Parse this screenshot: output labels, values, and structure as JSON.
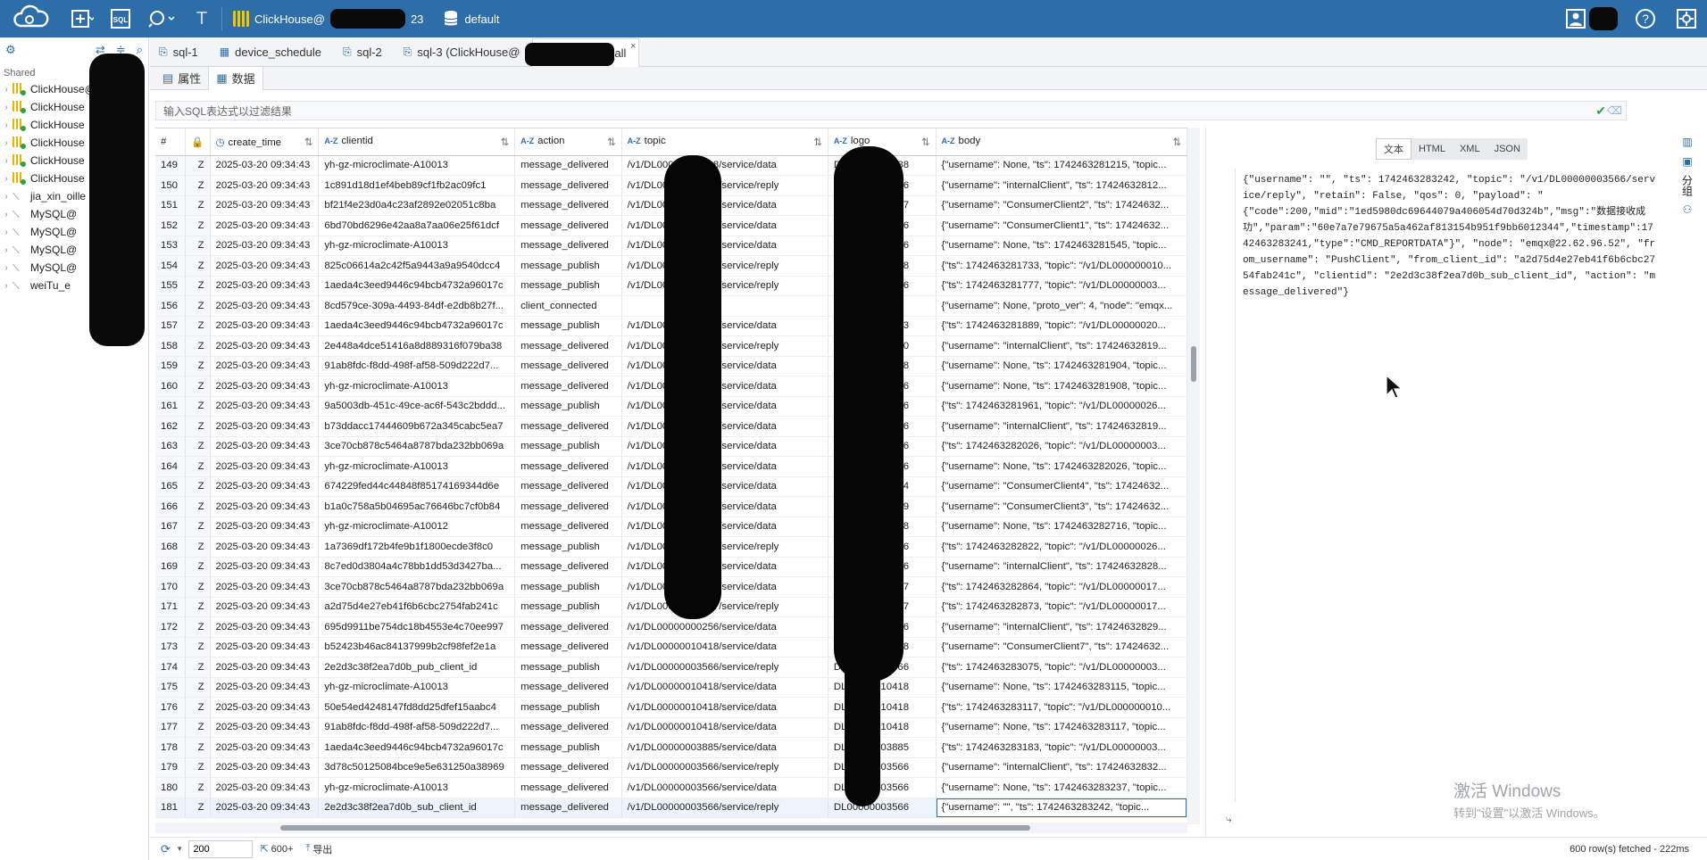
{
  "toolbar": {
    "connection_label": "ClickHouse@",
    "connection_suffix": "23",
    "database_label": "default"
  },
  "sidebar": {
    "shared_label": "Shared",
    "items": [
      {
        "label": "ClickHouse@",
        "type": "ch"
      },
      {
        "label": "ClickHouse",
        "type": "ch"
      },
      {
        "label": "ClickHouse",
        "type": "ch"
      },
      {
        "label": "ClickHouse",
        "type": "ch"
      },
      {
        "label": "ClickHouse",
        "type": "ch"
      },
      {
        "label": "ClickHouse",
        "type": "ch"
      },
      {
        "label": "jia_xin_oille",
        "type": "db"
      },
      {
        "label": "MySQL@",
        "type": "db"
      },
      {
        "label": "MySQL@",
        "type": "db"
      },
      {
        "label": "MySQL@",
        "type": "db"
      },
      {
        "label": "MySQL@",
        "type": "db"
      },
      {
        "label": "weiTu_e",
        "type": "db"
      }
    ]
  },
  "tabs": [
    {
      "label": "sql-1",
      "icon": "sql-script-icon"
    },
    {
      "label": "device_schedule",
      "icon": "table-icon"
    },
    {
      "label": "sql-2",
      "icon": "sql-script-icon"
    },
    {
      "label": "sql-3 (ClickHouse@",
      "icon": "sql-script-icon"
    },
    {
      "label": "emqx_log_all",
      "icon": "table-icon",
      "active": true
    }
  ],
  "subtabs": {
    "properties": "属性",
    "data": "数据"
  },
  "filter": {
    "placeholder": "输入SQL表达式以过滤结果"
  },
  "grid": {
    "columns": {
      "num": "#",
      "create_time": "create_time",
      "clientid": "clientid",
      "action": "action",
      "topic": "topic",
      "logo": "logo",
      "body": "body"
    },
    "type_az": "A-Z",
    "rows": [
      [
        "149",
        "Z",
        "2025-03-20 09:34:43",
        "yh-gz-microclimate-A10013",
        "message_delivered",
        "/v1/DL00000002238/service/data",
        "DL00000002238",
        "{\"username\": None, \"ts\": 1742463281215, \"topic..."
      ],
      [
        "150",
        "Z",
        "2025-03-20 09:34:43",
        "1c891d18d1ef4beb89cf1fb2ac09fc1",
        "message_delivered",
        "/v1/DL00000003486/service/reply",
        "DL00000003486",
        "{\"username\": \"internalClient\", \"ts\": 17424632812..."
      ],
      [
        "151",
        "Z",
        "2025-03-20 09:34:43",
        "bf21f4e23d0a4c23af2892e02051c8ba",
        "message_delivered",
        "/v1/DL00000001737/service/data",
        "DL00000001737",
        "{\"username\": \"ConsumerClient2\", \"ts\": 17424632..."
      ],
      [
        "152",
        "Z",
        "2025-03-20 09:34:43",
        "6bd70bd6296e42aa8a7aa06e25f61dcf",
        "message_delivered",
        "/v1/DL00000000256/service/data",
        "DL00000000256",
        "{\"username\": \"ConsumerClient1\", \"ts\": 17424632..."
      ],
      [
        "153",
        "Z",
        "2025-03-20 09:34:43",
        "yh-gz-microclimate-A10013",
        "message_delivered",
        "/v1/DL00000000256/service/data",
        "DL00000000256",
        "{\"username\": None, \"ts\": 1742463281545, \"topic..."
      ],
      [
        "154",
        "Z",
        "2025-03-20 09:34:43",
        "825c06614a2c42f5a9443a9a9540dcc4",
        "message_publish",
        "/v1/DL00000010418/service/reply",
        "DL00000010418",
        "{\"ts\": 1742463281733, \"topic\": \"/v1/DL000000010..."
      ],
      [
        "155",
        "Z",
        "2025-03-20 09:34:43",
        "1aeda4c3eed9446c94bcb4732a96017c",
        "message_publish",
        "/v1/DL00000003986/service/reply",
        "DL00000003986",
        "{\"ts\": 1742463281777, \"topic\": \"/v1/DL00000003..."
      ],
      [
        "156",
        "Z",
        "2025-03-20 09:34:43",
        "8cd579ce-309a-4493-84df-e2db8b27f...",
        "client_connected",
        "",
        "",
        "{\"username\": None, \"proto_ver\": 4, \"node\": \"emqx..."
      ],
      [
        "157",
        "Z",
        "2025-03-20 09:34:43",
        "1aeda4c3eed9446c94bcb4732a96017c",
        "message_publish",
        "/v1/DL00000002013/service/data",
        "DL00000002013",
        "{\"ts\": 1742463281889, \"topic\": \"/v1/DL00000020..."
      ],
      [
        "158",
        "Z",
        "2025-03-20 09:34:43",
        "2e448a4dce51416a8d889316f079ba38",
        "message_delivered",
        "/v1/DL00000010410/service/reply",
        "DL00000010410",
        "{\"username\": \"internalClient\", \"ts\": 17424632819..."
      ],
      [
        "159",
        "Z",
        "2025-03-20 09:34:43",
        "91ab8fdc-f8dd-498f-af58-509d222d7...",
        "message_delivered",
        "/v1/DL00000010418/service/data",
        "DL00000010418",
        "{\"username\": None, \"ts\": 1742463281904, \"topic..."
      ],
      [
        "160",
        "Z",
        "2025-03-20 09:34:43",
        "yh-gz-microclimate-A10013",
        "message_delivered",
        "/v1/DL00000000256/service/data",
        "DL00000000256",
        "{\"username\": None, \"ts\": 1742463281908, \"topic..."
      ],
      [
        "161",
        "Z",
        "2025-03-20 09:34:43",
        "9a5003db-451c-49ce-ac6f-543c2bddd...",
        "message_publish",
        "/v1/DL00000000256/service/data",
        "DL00000000256",
        "{\"ts\": 1742463281961, \"topic\": \"/v1/DL00000026..."
      ],
      [
        "162",
        "Z",
        "2025-03-20 09:34:43",
        "b73ddacc17444609b672a345cabc5ea7",
        "message_delivered",
        "/v1/DL00000000256/service/data",
        "DL00000000256",
        "{\"username\": \"internalClient\", \"ts\": 17424632819..."
      ],
      [
        "163",
        "Z",
        "2025-03-20 09:34:43",
        "3ce70cb878c5464a8787bda232bb069a",
        "message_publish",
        "/v1/DL00000003976/service/data",
        "DL00000003976",
        "{\"ts\": 1742463282026, \"topic\": \"/v1/DL00000003..."
      ],
      [
        "164",
        "Z",
        "2025-03-20 09:34:43",
        "yh-gz-microclimate-A10013",
        "message_delivered",
        "/v1/DL00000003976/service/data",
        "DL00000003976",
        "{\"username\": None, \"ts\": 1742463282026, \"topic..."
      ],
      [
        "165",
        "Z",
        "2025-03-20 09:34:43",
        "674229fed44c44848f85174169344d6e",
        "message_delivered",
        "/v1/DL00000014674/service/data",
        "DL00000014674",
        "{\"username\": \"ConsumerClient4\", \"ts\": 17424632..."
      ],
      [
        "166",
        "Z",
        "2025-03-20 09:34:43",
        "b1a0c758a5b04695ac76646bc7cf0b84",
        "message_delivered",
        "/v1/DL00000003789/service/data",
        "DL00000003789",
        "{\"username\": \"ConsumerClient3\", \"ts\": 17424632..."
      ],
      [
        "167",
        "Z",
        "2025-03-20 09:34:43",
        "yh-gz-microclimate-A10012",
        "message_delivered",
        "/v1/DL00000010418/service/data",
        "DL00000010418",
        "{\"username\": None, \"ts\": 1742463282716, \"topic..."
      ],
      [
        "168",
        "Z",
        "2025-03-20 09:34:43",
        "1a7369df172b4fe9b1f1800ecde3f8c0",
        "message_publish",
        "/v1/DL00000000256/service/reply",
        "DL00000000256",
        "{\"ts\": 1742463282822, \"topic\": \"/v1/DL00000026..."
      ],
      [
        "169",
        "Z",
        "2025-03-20 09:34:43",
        "8c7ed0d3804a4c78bb1dd53d3427ba...",
        "message_delivered",
        "/v1/DL00000000256/service/data",
        "DL00000000256",
        "{\"username\": \"internalClient\", \"ts\": 17424632828..."
      ],
      [
        "170",
        "Z",
        "2025-03-20 09:34:43",
        "3ce70cb878c5464a8787bda232bb069a",
        "message_publish",
        "/v1/DL00000001737/service/data",
        "DL00000001737",
        "{\"ts\": 1742463282864, \"topic\": \"/v1/DL00000017..."
      ],
      [
        "171",
        "Z",
        "2025-03-20 09:34:43",
        "a2d75d4e27eb41f6b6cbc2754fab241c",
        "message_publish",
        "/v1/DL00000001737/service/reply",
        "DL00000001737",
        "{\"ts\": 1742463282873, \"topic\": \"/v1/DL00000017..."
      ],
      [
        "172",
        "Z",
        "2025-03-20 09:34:43",
        "695d9911be754dc18b4553e4c70ee997",
        "message_delivered",
        "/v1/DL00000000256/service/data",
        "DL00000000256",
        "{\"username\": \"internalClient\", \"ts\": 17424632829..."
      ],
      [
        "173",
        "Z",
        "2025-03-20 09:34:43",
        "b52423b46ac84137999b2cf98fef2e1a",
        "message_delivered",
        "/v1/DL00000010418/service/data",
        "DL00000010418",
        "{\"username\": \"ConsumerClient7\", \"ts\": 17424632..."
      ],
      [
        "174",
        "Z",
        "2025-03-20 09:34:43",
        "2e2d3c38f2ea7d0b_pub_client_id",
        "message_publish",
        "/v1/DL00000003566/service/reply",
        "DL00000003566",
        "{\"ts\": 1742463283075, \"topic\": \"/v1/DL00000003..."
      ],
      [
        "175",
        "Z",
        "2025-03-20 09:34:43",
        "yh-gz-microclimate-A10013",
        "message_delivered",
        "/v1/DL00000010418/service/data",
        "DL00000010418",
        "{\"username\": None, \"ts\": 1742463283115, \"topic..."
      ],
      [
        "176",
        "Z",
        "2025-03-20 09:34:43",
        "50e54ed4248147fd8dd25dfef15aabc4",
        "message_publish",
        "/v1/DL00000010418/service/data",
        "DL00000010418",
        "{\"ts\": 1742463283117, \"topic\": \"/v1/DL000000010..."
      ],
      [
        "177",
        "Z",
        "2025-03-20 09:34:43",
        "91ab8fdc-f8dd-498f-af58-509d222d7...",
        "message_delivered",
        "/v1/DL00000010418/service/data",
        "DL00000010418",
        "{\"username\": None, \"ts\": 1742463283117, \"topic..."
      ],
      [
        "178",
        "Z",
        "2025-03-20 09:34:43",
        "1aeda4c3eed9446c94bcb4732a96017c",
        "message_publish",
        "/v1/DL00000003885/service/data",
        "DL00000003885",
        "{\"ts\": 1742463283183, \"topic\": \"/v1/DL00000003..."
      ],
      [
        "179",
        "Z",
        "2025-03-20 09:34:43",
        "3d78c50125084bce9e5e631250a38969",
        "message_delivered",
        "/v1/DL00000003566/service/reply",
        "DL00000003566",
        "{\"username\": \"internalClient\", \"ts\": 17424632832..."
      ],
      [
        "180",
        "Z",
        "2025-03-20 09:34:43",
        "yh-gz-microclimate-A10013",
        "message_delivered",
        "/v1/DL00000003566/service/data",
        "DL00000003566",
        "{\"username\": None, \"ts\": 1742463283237, \"topic..."
      ],
      [
        "181",
        "Z",
        "2025-03-20 09:34:43",
        "2e2d3c38f2ea7d0b_sub_client_id",
        "message_delivered",
        "/v1/DL00000003566/service/reply",
        "DL00000003566",
        "{\"username\": \"\", \"ts\": 1742463283242, \"topic..."
      ]
    ]
  },
  "preview": {
    "formats": [
      "文本",
      "HTML",
      "XML",
      "JSON"
    ],
    "active_format": "文本",
    "content": "{\"username\": \"\", \"ts\": 1742463283242, \"topic\": \"/v1/DL00000003566/service/reply\", \"retain\": False, \"qos\": 0, \"payload\": \"\n{\"code\":200,\"mid\":\"1ed5980dc69644079a406054d70d324b\",\"msg\":\"数据接收成\n功\",\"param\":\"60e7a7e79675a5a462af813154b951f9bb6012344\",\"timestamp\":1742463283241,\"type\":\"CMD_REPORTDATA\"}\", \"node\": \"emqx@22.62.96.52\", \"from_username\": \"PushClient\", \"from_client_id\": \"a2d75d4e27eb41f6b6cbc2754fab241c\", \"clientid\": \"2e2d3c38f2ea7d0b_sub_client_id\", \"action\": \"message_delivered\"}",
    "side_label": "分组"
  },
  "status": {
    "fetch_size": "200",
    "count_label": "600+",
    "export_label": "导出",
    "fetched_text": "600 row(s) fetched - 222ms"
  },
  "watermark": {
    "line1": "激活 Windows",
    "line2": "转到\"设置\"以激活 Windows。"
  },
  "colors": {
    "topbar": "#2d6da8",
    "accent": "#2d6da8"
  }
}
